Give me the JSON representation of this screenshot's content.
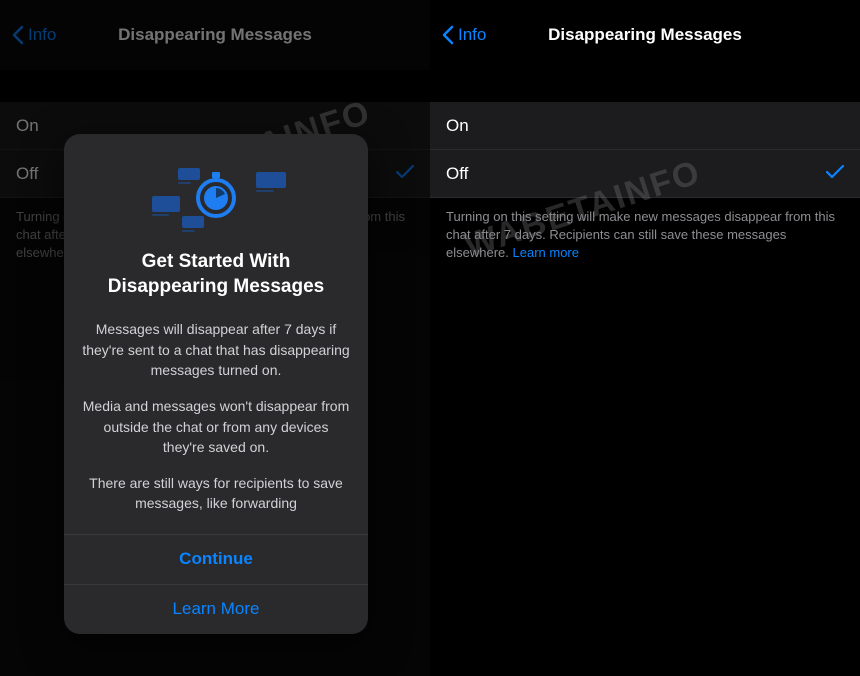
{
  "watermark": "WABETAINFO",
  "left": {
    "back_label": "Info",
    "title": "Disappearing Messages",
    "options": [
      {
        "label": "On",
        "selected": false
      },
      {
        "label": "Off",
        "selected": true
      }
    ],
    "footer": "Turning on this setting will make new messages disappear from this chat after 7 days. Recipients can still save these messages elsewhere.",
    "learn_more": "Learn more"
  },
  "right": {
    "back_label": "Info",
    "title": "Disappearing Messages",
    "options": [
      {
        "label": "On",
        "selected": false
      },
      {
        "label": "Off",
        "selected": true
      }
    ],
    "footer": "Turning on this setting will make new messages disappear from this chat after 7 days. Recipients can still save these messages elsewhere.",
    "learn_more": "Learn more"
  },
  "modal": {
    "title_line1": "Get Started With",
    "title_line2": "Disappearing Messages",
    "para1": "Messages will disappear after 7 days if they're sent to a chat that has disappearing messages turned on.",
    "para2": "Media and messages won't disappear from outside the chat or from any devices they're saved on.",
    "para3": "There are still ways for recipients to save messages, like forwarding",
    "continue": "Continue",
    "learn_more": "Learn More"
  }
}
